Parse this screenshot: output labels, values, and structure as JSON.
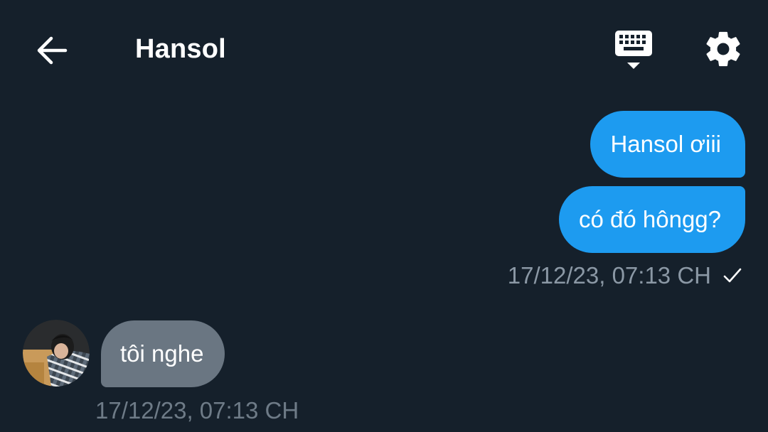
{
  "header": {
    "title": "Hansol",
    "back_icon": "arrow-left-icon",
    "keyboard_icon": "keyboard-icon",
    "settings_icon": "gear-icon"
  },
  "conversation": {
    "outgoing": [
      {
        "text": "Hansol ơiii"
      },
      {
        "text": "có đó hôngg?"
      }
    ],
    "outgoing_timestamp": "17/12/23, 07:13 CH",
    "outgoing_status_icon": "check-icon",
    "incoming": [
      {
        "text": "tôi nghe"
      }
    ],
    "incoming_timestamp": "17/12/23, 07:13 CH"
  },
  "colors": {
    "background": "#15202b",
    "outgoing_bubble": "#1d9bf0",
    "incoming_bubble": "#6a7682",
    "meta_text": "#8b98a5"
  }
}
